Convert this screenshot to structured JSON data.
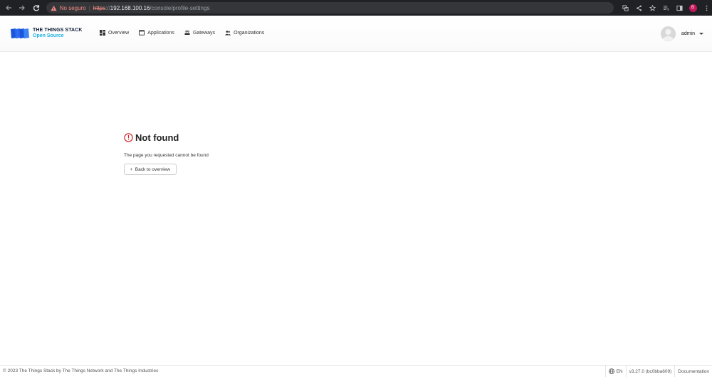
{
  "browser": {
    "not_secure": "No seguro",
    "url_scheme": "https",
    "url_sep": "://",
    "url_host": "192.168.100.16",
    "url_path": "/console/profile-settings",
    "profile_initial": "B"
  },
  "header": {
    "logo_title": "THE THINGS STACK",
    "logo_subtitle": "Open Source",
    "nav": [
      {
        "label": "Overview",
        "icon": "grid-icon"
      },
      {
        "label": "Applications",
        "icon": "window-icon"
      },
      {
        "label": "Gateways",
        "icon": "router-icon"
      },
      {
        "label": "Organizations",
        "icon": "people-icon"
      }
    ],
    "username": "admin"
  },
  "main": {
    "title": "Not found",
    "message": "The page you requested cannot be found",
    "back_label": "Back to overview"
  },
  "footer": {
    "copyright": "© 2023 The Things Stack by The Things Network and The Things Industries",
    "language": "EN",
    "version": "v3.27.0 (bc0bba609)",
    "documentation": "Documentation"
  },
  "colors": {
    "error": "#db2328",
    "brand_blue": "#1a56db",
    "brand_cyan": "#1cb0e4"
  }
}
